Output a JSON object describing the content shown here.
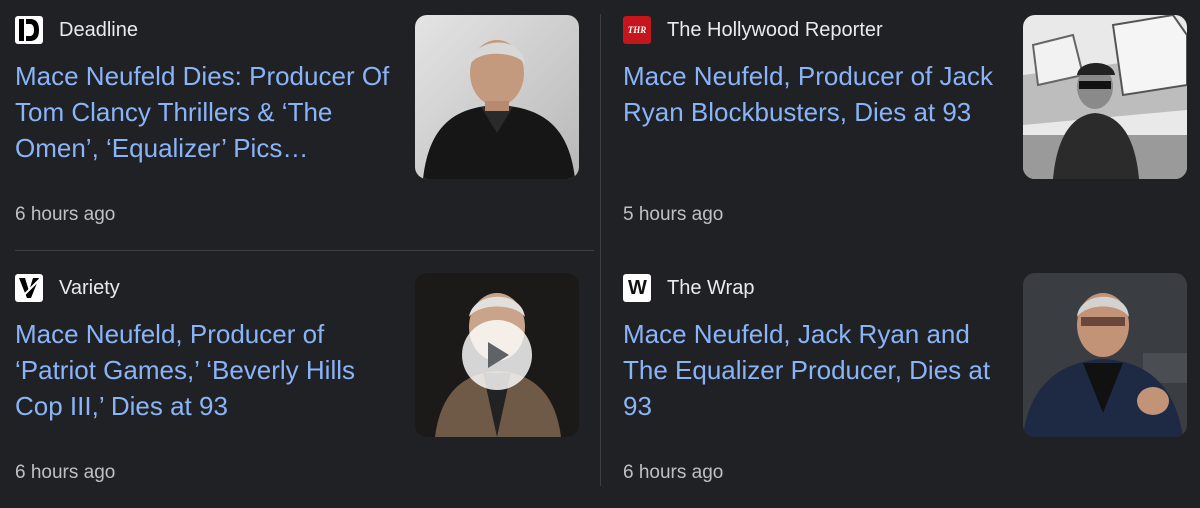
{
  "articles": [
    {
      "source": "Deadline",
      "logo_icon": "deadline-logo",
      "headline": "Mace Neufeld Dies: Producer Of Tom Clancy Thrillers & ‘The Omen’, ‘Equalizer’ Pics…",
      "time": "6 hours ago",
      "has_video": false
    },
    {
      "source": "The Hollywood Reporter",
      "logo_icon": "thr-logo",
      "logo_text": "THR",
      "headline": "Mace Neufeld, Producer of Jack Ryan Blockbusters, Dies at 93",
      "time": "5 hours ago",
      "has_video": false
    },
    {
      "source": "Variety",
      "logo_icon": "variety-logo",
      "headline": "Mace Neufeld, Producer of ‘Patriot Games,’ ‘Beverly Hills Cop III,’ Dies at 93",
      "time": "6 hours ago",
      "has_video": true
    },
    {
      "source": "The Wrap",
      "logo_icon": "thewrap-logo",
      "logo_text": "W",
      "headline": "Mace Neufeld, Jack Ryan and The Equalizer Producer, Dies at 93",
      "time": "6 hours ago",
      "has_video": false
    }
  ],
  "colors": {
    "background": "#202124",
    "headline": "#8ab4f8",
    "source": "#e8eaed",
    "meta": "#bdc1c6",
    "divider": "#3c4043"
  }
}
